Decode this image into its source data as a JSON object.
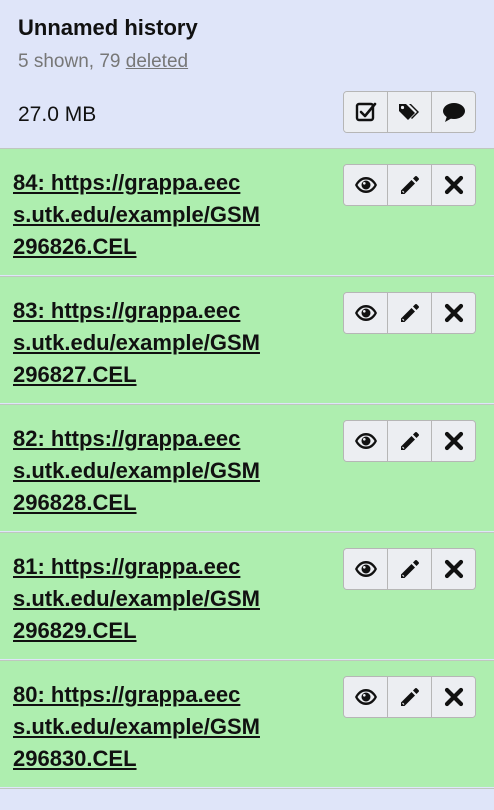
{
  "history": {
    "name": "Unnamed history",
    "shown_text": "5 shown, 79 ",
    "deleted_link": "deleted",
    "size": "27.0 MB",
    "header_buttons": [
      "checkbox-icon",
      "tags-icon",
      "comment-icon"
    ]
  },
  "datasets": [
    {
      "hid": "84",
      "line1": "84: https://grappa.eec",
      "line2": "s.utk.edu/example/GSM",
      "line3": "296826.CEL",
      "state_color": "#aeeeaf"
    },
    {
      "hid": "83",
      "line1": "83: https://grappa.eec",
      "line2": "s.utk.edu/example/GSM",
      "line3": "296827.CEL",
      "state_color": "#aeeeaf"
    },
    {
      "hid": "82",
      "line1": "82: https://grappa.eec",
      "line2": "s.utk.edu/example/GSM",
      "line3": "296828.CEL",
      "state_color": "#aeeeaf"
    },
    {
      "hid": "81",
      "line1": "81: https://grappa.eec",
      "line2": "s.utk.edu/example/GSM",
      "line3": "296829.CEL",
      "state_color": "#aeeeaf"
    },
    {
      "hid": "80",
      "line1": "80: https://grappa.eec",
      "line2": "s.utk.edu/example/GSM",
      "line3": "296830.CEL",
      "state_color": "#aeeeaf"
    }
  ],
  "dataset_buttons": [
    "eye-icon",
    "pencil-icon",
    "delete-icon"
  ],
  "colors": {
    "header_bg": "#dfe5f9",
    "ok_bg": "#aeeeaf",
    "button_bg": "#eceef2"
  }
}
